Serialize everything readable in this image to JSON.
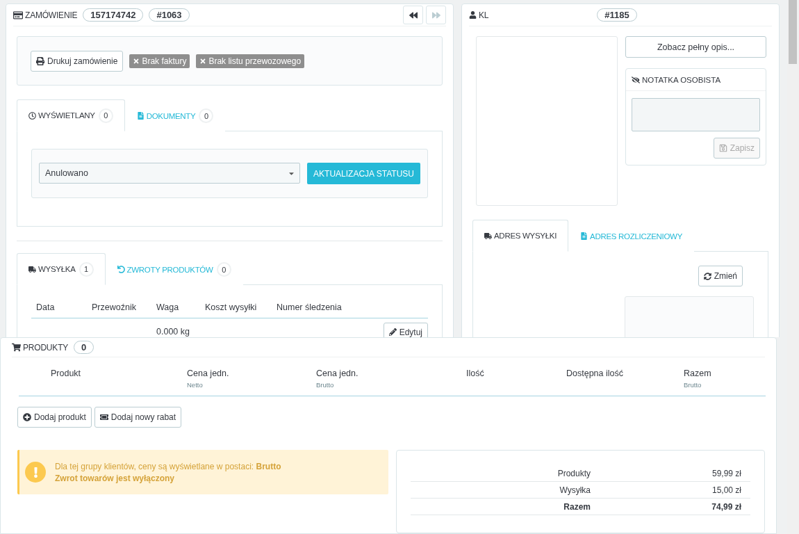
{
  "order": {
    "title": "ZAMÓWIENIE",
    "badges": [
      "157174742",
      "#1063"
    ]
  },
  "actions": [
    {
      "kind": "button",
      "label": "Drukuj zamówienie"
    },
    {
      "kind": "tag",
      "label": "Brak faktury"
    },
    {
      "kind": "tag",
      "label": "Brak listu przewozowego"
    }
  ],
  "status_tabs": [
    {
      "label": "WYŚWIETLANY",
      "count": "0",
      "selected": true
    },
    {
      "label": "DOKUMENTY",
      "count": "0",
      "selected": false
    }
  ],
  "status": {
    "value": "Anulowano",
    "button": "AKTUALIZACJA STATUSU"
  },
  "shipping_tabs": [
    {
      "label": "WYSYŁKA",
      "count": "1",
      "selected": true
    },
    {
      "label": "ZWROTY PRODUKTÓW",
      "count": "0",
      "selected": false
    }
  ],
  "shipping_table": {
    "columns": [
      "Data",
      "Przewoźnik",
      "Waga",
      "Koszt wysyłki",
      "Numer śledzenia"
    ],
    "rows": [
      {
        "cells": [
          "",
          "",
          "0.000 kg",
          "",
          ""
        ],
        "action": "Edytuj"
      }
    ]
  },
  "customer": {
    "title": "KL",
    "badge": "#1185",
    "full_button": "Zobacz pełny opis...",
    "note": {
      "title": "NOTATKA OSOBISTA",
      "save": "Zapisz",
      "save_disabled": true
    }
  },
  "address_tabs": [
    {
      "label": "ADRES WYSYŁKI",
      "selected": true
    },
    {
      "label": "ADRES ROZLICZENIOWY",
      "selected": false
    }
  ],
  "address": {
    "change": "Zmień"
  },
  "products": {
    "title": "PRODUKTY",
    "count": "0",
    "columns": [
      {
        "label": "Produkt"
      },
      {
        "label": "Cena jedn.",
        "sub": "Netto"
      },
      {
        "label": "Cena jedn.",
        "sub": "Brutto"
      },
      {
        "label": "Ilość"
      },
      {
        "label": "Dostępna ilość"
      },
      {
        "label": "Razem",
        "sub": "Brutto"
      }
    ],
    "buttons": [
      "Dodaj produkt",
      "Dodaj nowy rabat"
    ]
  },
  "alert": {
    "lines": [
      {
        "text": "Dla tej grupy klientów, ceny są wyświetlane w postaci: **Brutto**",
        "bold": false
      },
      {
        "text": "Zwrot towarów jest wyłączony",
        "bold": true
      }
    ]
  },
  "totals": [
    {
      "label": "Produkty",
      "value": "59,99 zł",
      "bold": false
    },
    {
      "label": "Wysyłka",
      "value": "15,00 zł",
      "bold": false
    },
    {
      "label": "Razem",
      "value": "74,99 zł",
      "bold": true
    }
  ]
}
